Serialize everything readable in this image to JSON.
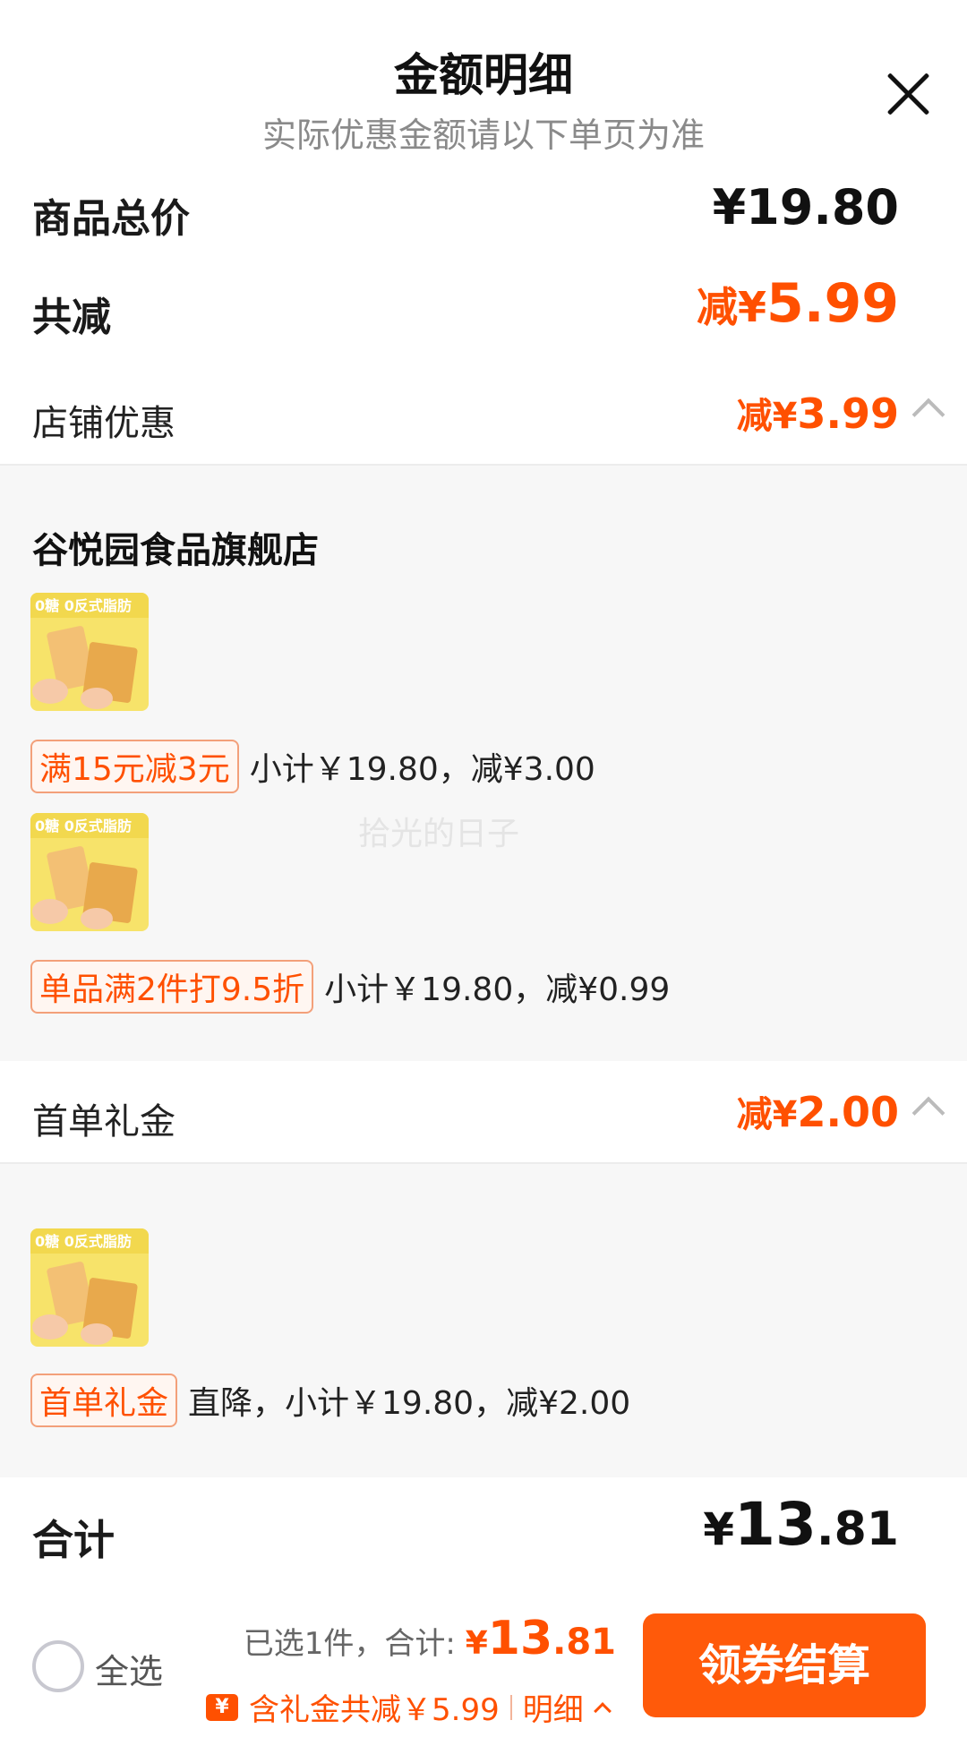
{
  "header": {
    "title": "金额明细",
    "subtitle": "实际优惠金额请以下单页为准"
  },
  "summary": {
    "goods_total_label": "商品总价",
    "goods_total_value": "¥19.80",
    "discount_label": "共减",
    "discount_currency": "减¥",
    "discount_amount": "5.99"
  },
  "store_section": {
    "label": "店铺优惠",
    "currency": "减¥",
    "amount": "3.99",
    "store_name": "谷悦园食品旗舰店",
    "items": [
      {
        "thumb_text": "0糖 0反式脂肪",
        "tag": "满15元减3元",
        "detail": "小计￥19.80，减¥3.00"
      },
      {
        "thumb_text": "0糖 0反式脂肪",
        "tag": "单品满2件打9.5折",
        "detail": "小计￥19.80，减¥0.99"
      }
    ]
  },
  "gift_section": {
    "label": "首单礼金",
    "currency": "减¥",
    "amount": "2.00",
    "items": [
      {
        "thumb_text": "0糖 0反式脂肪",
        "tag": "首单礼金",
        "detail": "直降，小计￥19.80，减¥2.00"
      }
    ]
  },
  "watermark": "拾光的日子",
  "total": {
    "label": "合计",
    "currency": "¥",
    "integer": "13",
    "decimal": ".81"
  },
  "bottom_bar": {
    "select_all": "全选",
    "selected_text": "已选1件，合计: ",
    "price_currency": "¥",
    "price_integer": "13",
    "price_decimal": ".81",
    "gift_icon": "¥",
    "gift_text": "含礼金共减￥5.99",
    "detail_link": "明细",
    "checkout_label": "领券结算"
  },
  "colors": {
    "accent": "#ff5000",
    "button": "#ff5a0a",
    "section_bg": "#f7f7f7"
  }
}
